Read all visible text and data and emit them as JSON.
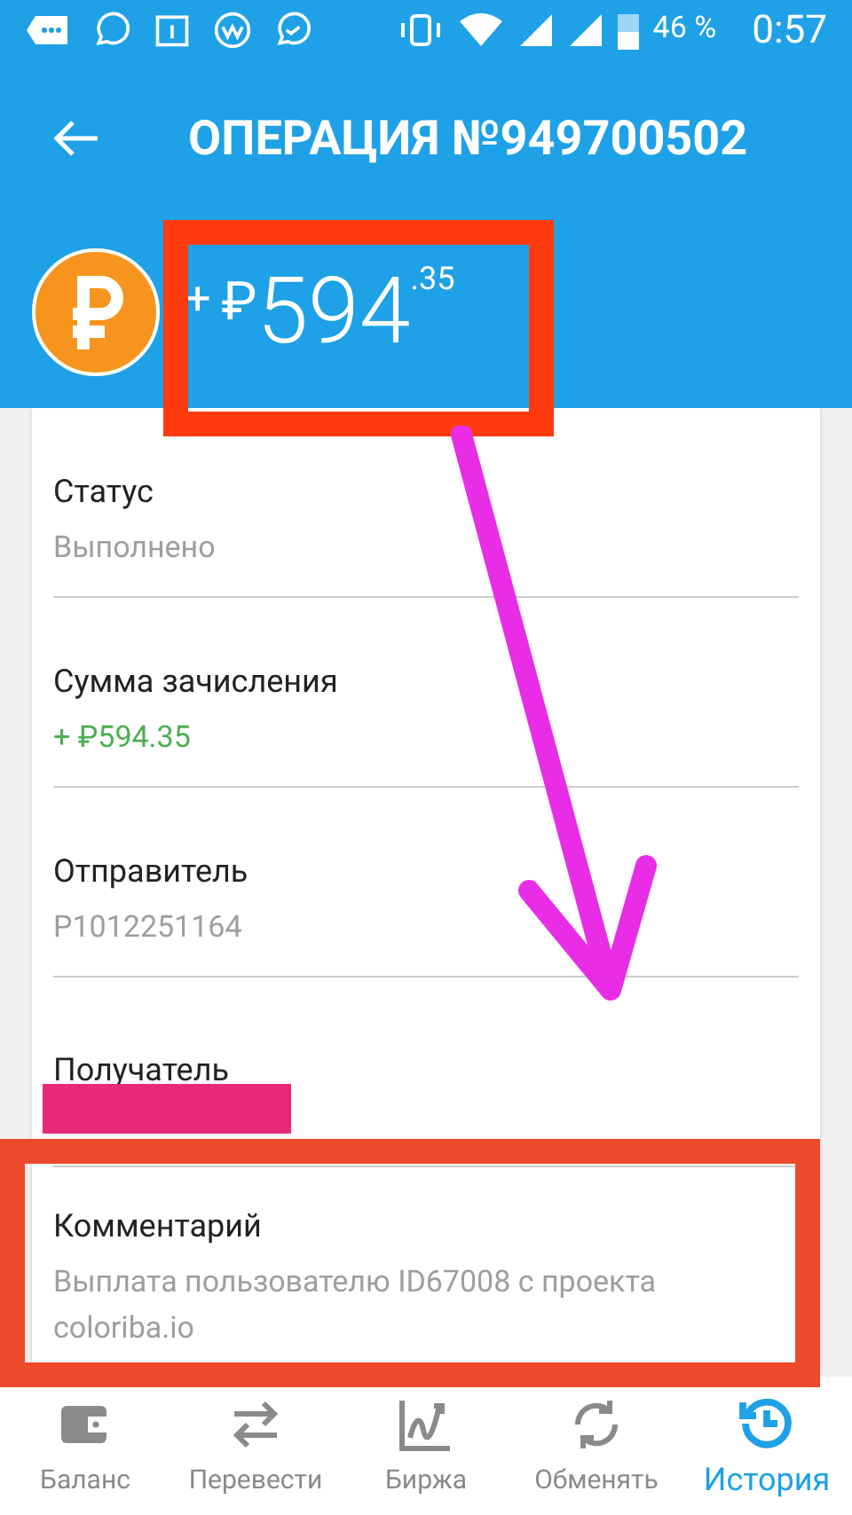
{
  "status_bar": {
    "battery": "46 %",
    "time": "0:57"
  },
  "header": {
    "title": "ОПЕРАЦИЯ №949700502"
  },
  "amount": {
    "sign": "+",
    "currency": "₽",
    "whole": "594",
    "fraction": ".35"
  },
  "details": [
    {
      "label": "Статус",
      "value": "Выполнено",
      "kind": "plain"
    },
    {
      "label": "Сумма зачисления",
      "value": "+ ₽594.35",
      "kind": "positive"
    },
    {
      "label": "Отправитель",
      "value": "P1012251164",
      "kind": "plain"
    },
    {
      "label": "Получатель",
      "kind": "redacted"
    },
    {
      "label": "Комментарий",
      "value": "Выплата пользователю ID67008 с проекта coloriba.io",
      "kind": "plain"
    }
  ],
  "nav": [
    {
      "label": "Баланс",
      "kind": "wallet",
      "selected": false
    },
    {
      "label": "Перевести",
      "kind": "transfer",
      "selected": false
    },
    {
      "label": "Биржа",
      "kind": "chart",
      "selected": false
    },
    {
      "label": "Обменять",
      "kind": "exchange",
      "selected": false
    },
    {
      "label": "История",
      "kind": "history",
      "selected": true
    }
  ]
}
